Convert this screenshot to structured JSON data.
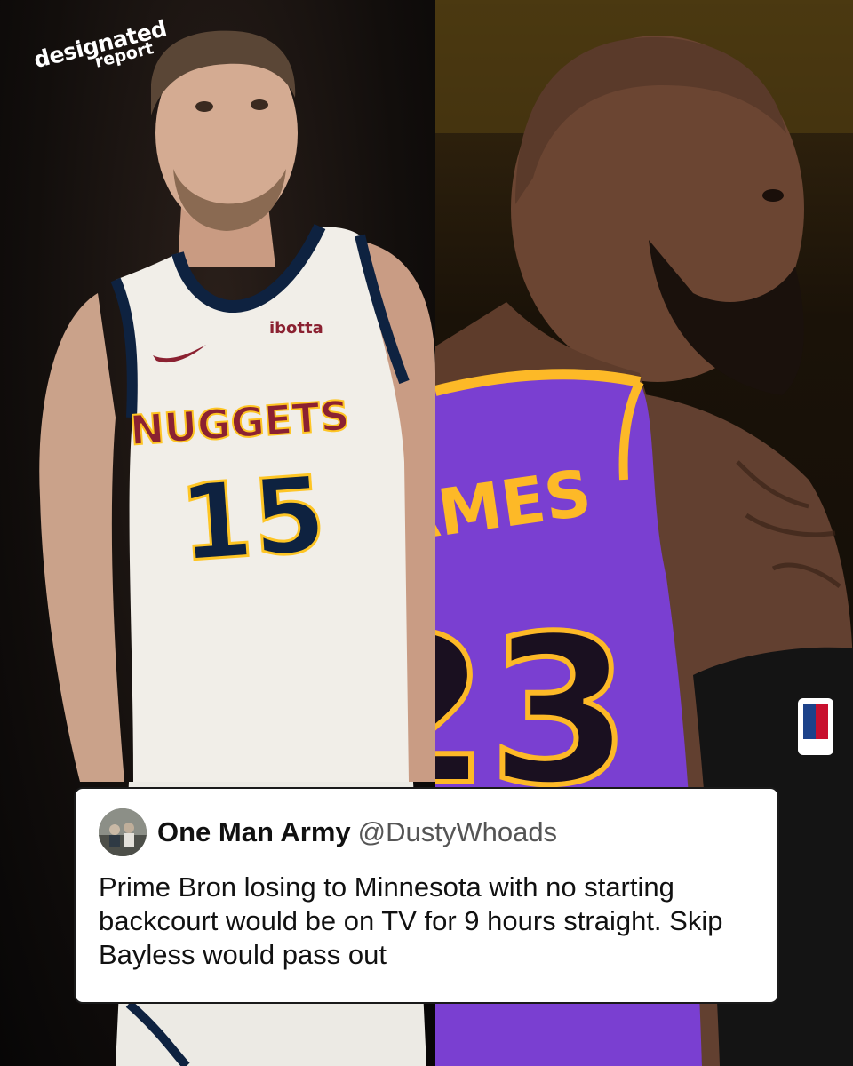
{
  "brand": {
    "line1": "designated",
    "line2": "report"
  },
  "left_photo": {
    "team_wordmark": "NUGGETS",
    "jersey_number": "15",
    "sponsor": "ibotta",
    "colors": {
      "jersey": "#f1eee8",
      "navy": "#0e2240",
      "red": "#8b2131",
      "gold": "#fec524"
    }
  },
  "right_photo": {
    "jersey_name": "AMES",
    "jersey_number": "23",
    "colors": {
      "jersey": "#7a3fd1",
      "gold": "#fdb927"
    }
  },
  "tweet": {
    "display_name": "One Man Army",
    "handle": "@DustyWhoads",
    "text": "Prime Bron losing to Minnesota with no starting backcourt would be on TV for 9 hours straight. Skip Bayless would pass out"
  }
}
